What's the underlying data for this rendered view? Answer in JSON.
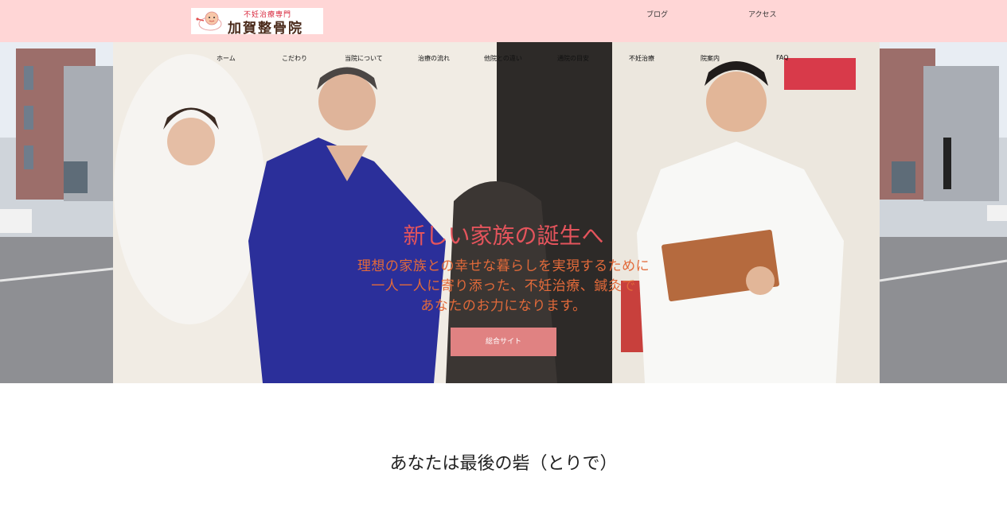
{
  "header": {
    "logo": {
      "tagline": "不妊治療専門",
      "name": "加賀整骨院"
    },
    "top_links": [
      "ブログ",
      "アクセス"
    ]
  },
  "nav": {
    "items": [
      "ホーム",
      "こだわり",
      "当院について",
      "治療の流れ",
      "他院との違い",
      "通院の目安",
      "不妊治療",
      "院案内",
      "FAQ"
    ]
  },
  "hero": {
    "title": "新しい家族の誕生へ",
    "lines": [
      "理想の家族との幸せな暮らしを実現するために",
      "一人一人に寄り添った、不妊治療、鍼灸で",
      "あなたのお力になります。"
    ],
    "cta_label": "総合サイト"
  },
  "main": {
    "section_title": "あなたは最後の砦（とりで）"
  },
  "colors": {
    "header_bg": "#ffd6d6",
    "title": "#e4545c",
    "subtitle": "#e26a3a",
    "cta_bg": "#e08282"
  }
}
